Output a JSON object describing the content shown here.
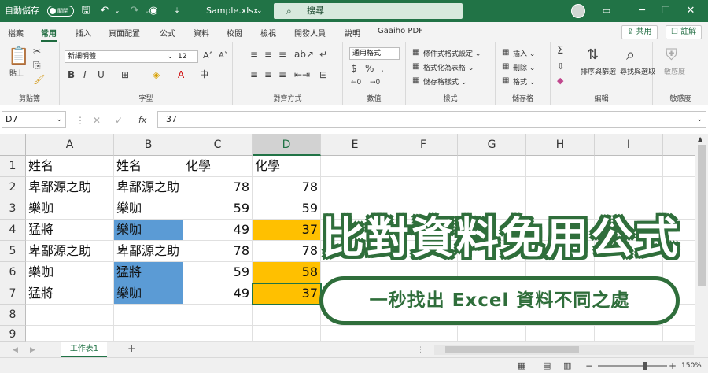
{
  "titlebar": {
    "autosave_label": "自動儲存",
    "autosave_state": "關閉",
    "filename": "Sample.xlsx",
    "filename_suffix": "⌄",
    "search_placeholder": "搜尋",
    "window_buttons": [
      "─",
      "☐",
      "✕"
    ]
  },
  "menu": {
    "tabs": [
      "檔案",
      "常用",
      "插入",
      "頁面配置",
      "公式",
      "資料",
      "校閱",
      "檢視",
      "開發人員",
      "說明",
      "Gaaiho PDF"
    ],
    "active": "常用",
    "share": "共用",
    "comment": "註解"
  },
  "ribbon": {
    "groups": [
      "剪貼簿",
      "字型",
      "對齊方式",
      "數值",
      "樣式",
      "儲存格",
      "編輯",
      "敏感度"
    ],
    "paste_label": "貼上",
    "font_name": "新細明體",
    "font_size": "12",
    "number_format": "通用格式",
    "style_items": [
      "條件式格式設定 ⌄",
      "格式化為表格 ⌄",
      "儲存格樣式 ⌄"
    ],
    "cell_items": [
      "插入 ⌄",
      "刪除 ⌄",
      "格式 ⌄"
    ],
    "sort_label": "排序與篩選",
    "find_label": "尋找與選取",
    "sensitivity_label": "敏感度"
  },
  "formula_bar": {
    "name_box": "D7",
    "fx": "fx",
    "value": "37"
  },
  "grid": {
    "columns": [
      "A",
      "B",
      "C",
      "D",
      "E",
      "F",
      "G",
      "H",
      "I"
    ],
    "selected_column": "D",
    "rows": [
      "1",
      "2",
      "3",
      "4",
      "5",
      "6",
      "7",
      "8",
      "9"
    ],
    "cells": [
      [
        "姓名",
        "姓名",
        "化學",
        "化學"
      ],
      [
        "卑鄙源之助",
        "卑鄙源之助",
        "78",
        "78"
      ],
      [
        "樂咖",
        "樂咖",
        "59",
        "59"
      ],
      [
        "猛將",
        "樂咖",
        "49",
        "37"
      ],
      [
        "卑鄙源之助",
        "卑鄙源之助",
        "78",
        "78"
      ],
      [
        "樂咖",
        "猛將",
        "59",
        "58"
      ],
      [
        "猛將",
        "樂咖",
        "49",
        "37"
      ]
    ],
    "highlight_blue": "#5b9bd5",
    "highlight_orange": "#ffc000"
  },
  "sheetbar": {
    "sheet_name": "工作表1",
    "add_label": "+"
  },
  "statusbar": {
    "zoom": "150%"
  },
  "overlay": {
    "title": "比對資料免用公式",
    "subtitle": "一秒找出 Excel 資料不同之處"
  },
  "colors": {
    "excel_green": "#217346",
    "banner_green": "#2f6e3b"
  }
}
